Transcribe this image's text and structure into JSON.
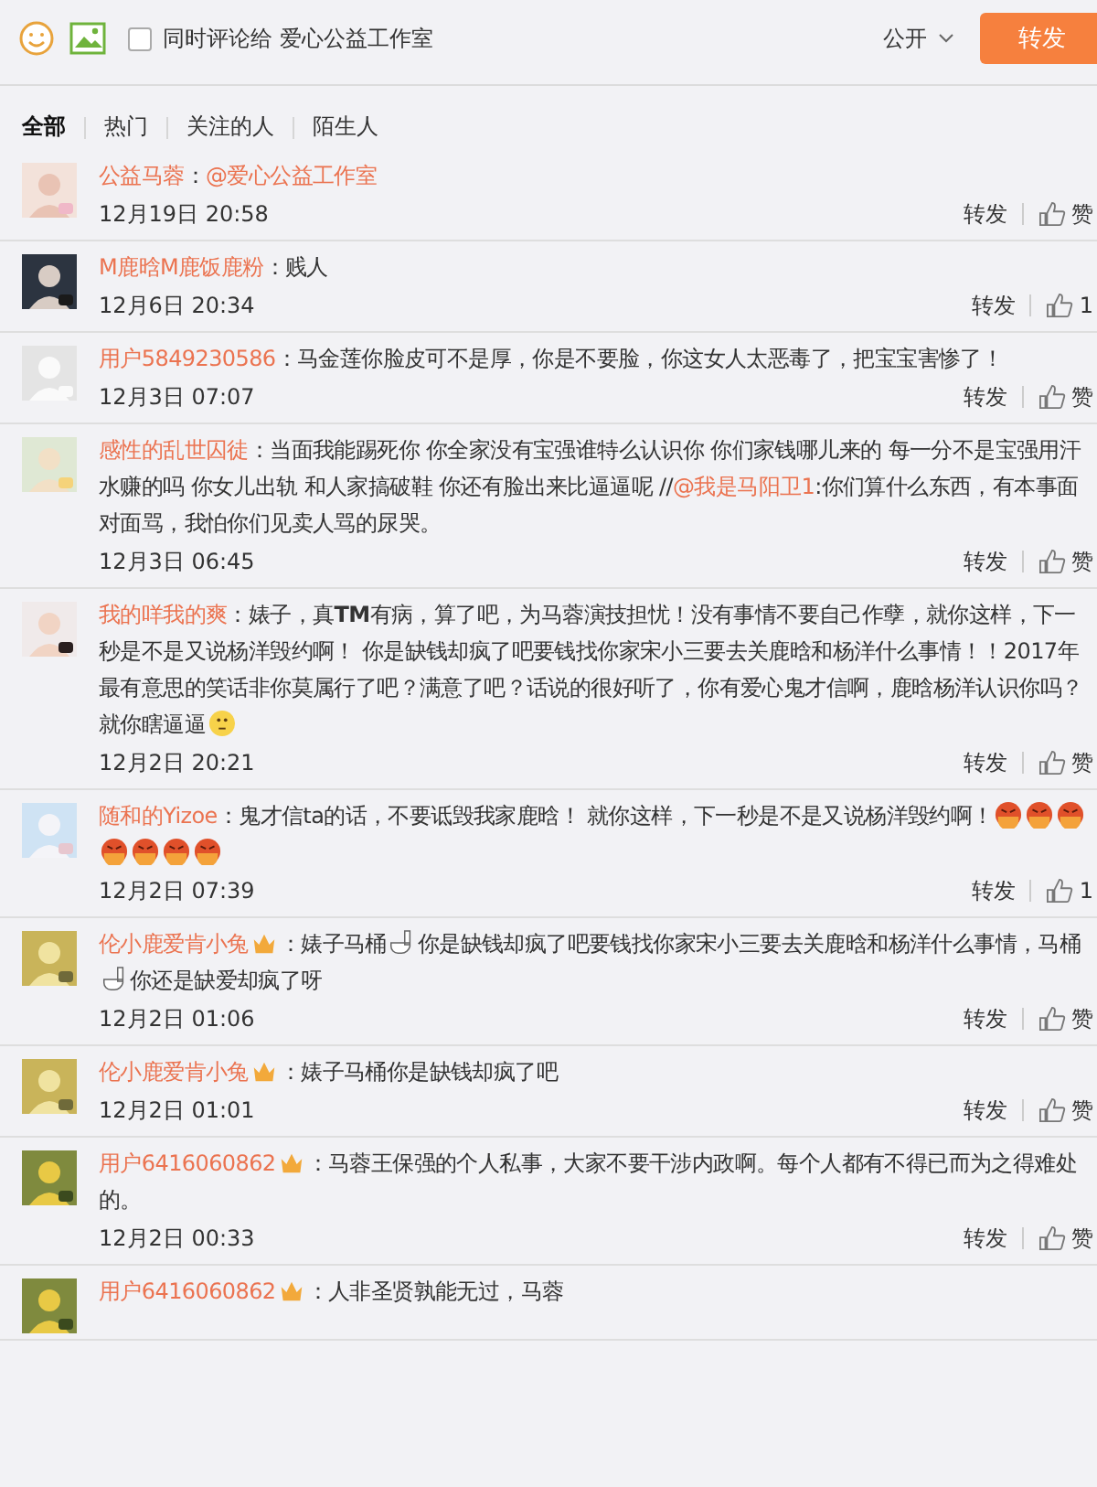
{
  "compose": {
    "share_checkbox": {
      "label": "同时评论给 爱心公益工作室",
      "checked": false
    },
    "visibility": "公开",
    "submit": "转发"
  },
  "tabs": [
    {
      "label": "全部",
      "selected": true
    },
    {
      "label": "热门",
      "selected": false
    },
    {
      "label": "关注的人",
      "selected": false
    },
    {
      "label": "陌生人",
      "selected": false
    }
  ],
  "comments": [
    {
      "name": "公益马蓉",
      "badge": false,
      "parts": [
        {
          "kind": "text",
          "text": "："
        },
        {
          "kind": "mention",
          "text": "@爱心公益工作室"
        }
      ],
      "time": "12月19日 20:58",
      "repost": "转发",
      "like": "赞"
    },
    {
      "name": "M鹿晗M鹿饭鹿粉",
      "badge": false,
      "parts": [
        {
          "kind": "text",
          "text": "：贱人"
        }
      ],
      "time": "12月6日 20:34",
      "repost": "转发",
      "like": "1"
    },
    {
      "name": "用户5849230586",
      "badge": false,
      "parts": [
        {
          "kind": "text",
          "text": "：马金莲你脸皮可不是厚，你是不要脸，你这女人太恶毒了，把宝宝害惨了！"
        }
      ],
      "time": "12月3日 07:07",
      "repost": "转发",
      "like": "赞"
    },
    {
      "name": "感性的乱世囚徒",
      "badge": false,
      "parts": [
        {
          "kind": "text",
          "text": "：当面我能踢死你 你全家没有宝强谁特么认识你 你们家钱哪儿来的 每一分不是宝强用汗水赚的吗 你女儿出轨 和人家搞破鞋 你还有脸出来比逼逼呢 //"
        },
        {
          "kind": "mention",
          "text": "@我是马阳卫1"
        },
        {
          "kind": "text",
          "text": ":你们算什么东西，有本事面对面骂，我怕你们见卖人骂的尿哭。"
        }
      ],
      "time": "12月3日 06:45",
      "repost": "转发",
      "like": "赞"
    },
    {
      "name": "我的咩我的爽",
      "badge": false,
      "parts": [
        {
          "kind": "text",
          "text": "：婊子，真**TM**有病，算了吧，为马蓉演技担忧！没有事情不要自己作孽，就你这样，下一秒是不是又说杨洋毁约啊！ 你是缺钱却疯了吧要钱找你家宋小三要去关鹿晗和杨洋什么事情！！2017年最有意思的笑话非你莫属行了吧？满意了吧？话说的很好听了，你有爱心鬼才信啊，鹿晗杨洋认识你吗？就你瞎逼逼"
        },
        {
          "kind": "thinking"
        }
      ],
      "time": "12月2日 20:21",
      "repost": "转发",
      "like": "赞"
    },
    {
      "name": "随和的Yizoe",
      "badge": false,
      "parts": [
        {
          "kind": "text",
          "text": "：鬼才信ta的话，不要诋毁我家鹿晗！ 就你这样，下一秒是不是又说杨洋毁约啊！"
        },
        {
          "kind": "angry"
        },
        {
          "kind": "angry"
        },
        {
          "kind": "angry"
        },
        {
          "kind": "angry"
        },
        {
          "kind": "angry"
        },
        {
          "kind": "angry"
        },
        {
          "kind": "angry"
        }
      ],
      "time": "12月2日 07:39",
      "repost": "转发",
      "like": "1"
    },
    {
      "name": "伦小鹿爱肯小兔",
      "badge": true,
      "parts": [
        {
          "kind": "text",
          "text": "：婊子马桶"
        },
        {
          "kind": "toilet"
        },
        {
          "kind": "text",
          "text": "你是缺钱却疯了吧要钱找你家宋小三要去关鹿晗和杨洋什么事情，马桶"
        },
        {
          "kind": "toilet"
        },
        {
          "kind": "text",
          "text": "你还是缺爱却疯了呀"
        }
      ],
      "time": "12月2日 01:06",
      "repost": "转发",
      "like": "赞"
    },
    {
      "name": "伦小鹿爱肯小兔",
      "badge": true,
      "parts": [
        {
          "kind": "text",
          "text": "：婊子马桶你是缺钱却疯了吧"
        }
      ],
      "time": "12月2日 01:01",
      "repost": "转发",
      "like": "赞"
    },
    {
      "name": "用户6416060862",
      "badge": true,
      "parts": [
        {
          "kind": "text",
          "text": "：马蓉王保强的个人私事，大家不要干涉内政啊。每个人都有不得已而为之得难处的。"
        }
      ],
      "time": "12月2日 00:33",
      "repost": "转发",
      "like": "赞"
    },
    {
      "name": "用户6416060862",
      "badge": true,
      "parts": [
        {
          "kind": "text",
          "text": "：人非圣贤孰能无过，马蓉"
        }
      ]
    }
  ]
}
